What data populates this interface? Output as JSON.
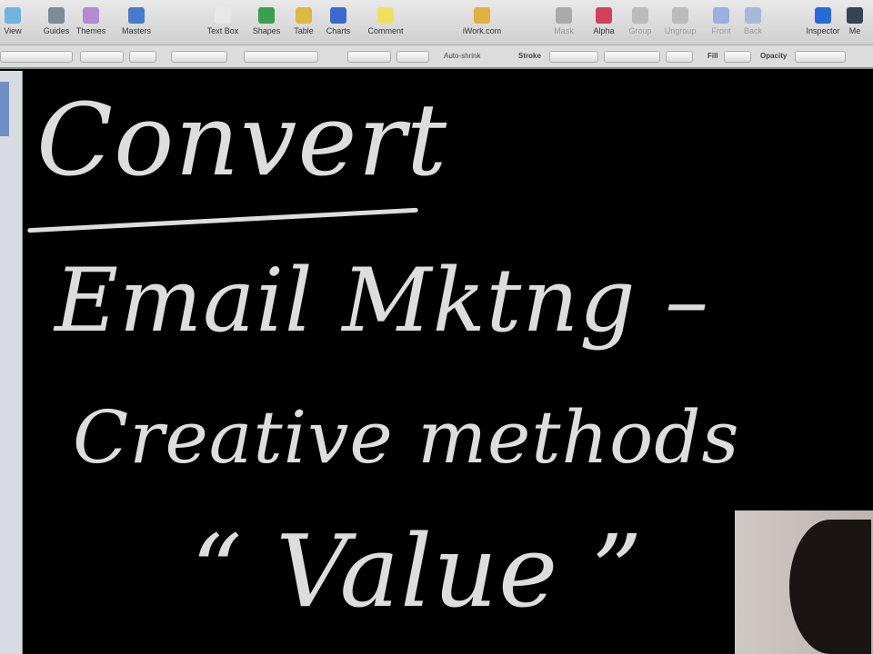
{
  "toolbar": {
    "items": [
      {
        "label": "View",
        "color": "#6fb3e0"
      },
      {
        "label": "Guides",
        "color": "#7c8a99"
      },
      {
        "label": "Themes",
        "color": "#b48ad0"
      },
      {
        "label": "Masters",
        "color": "#4a7ad0"
      },
      {
        "label": "Text Box",
        "color": "#e8e8e8"
      },
      {
        "label": "Shapes",
        "color": "#3aa050"
      },
      {
        "label": "Table",
        "color": "#e0b840"
      },
      {
        "label": "Charts",
        "color": "#3a6ad0"
      },
      {
        "label": "Comment",
        "color": "#f0e060"
      },
      {
        "label": "iWork.com",
        "color": "#e0b040"
      },
      {
        "label": "Mask",
        "color": "#aaa"
      },
      {
        "label": "Alpha",
        "color": "#d04060"
      },
      {
        "label": "Group",
        "color": "#bbb"
      },
      {
        "label": "Ungroup",
        "color": "#bbb"
      },
      {
        "label": "Front",
        "color": "#9ab0e0"
      },
      {
        "label": "Back",
        "color": "#aab8d8"
      },
      {
        "label": "Inspector",
        "color": "#2a6ad8"
      },
      {
        "label": "Me",
        "color": "#345"
      }
    ]
  },
  "formatbar": {
    "auto_shrink": "Auto-shrink",
    "stroke": "Stroke",
    "fill": "Fill",
    "opacity": "Opacity"
  },
  "slide": {
    "title": "Convert",
    "line1": "Email Mktng –",
    "line2": "Creative methods",
    "line3": "“ Value ”"
  }
}
